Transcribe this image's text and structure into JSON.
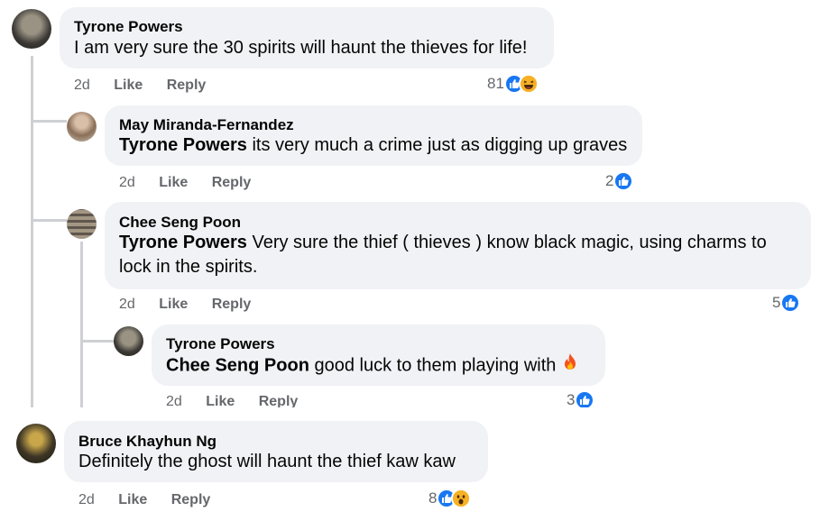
{
  "comments": [
    {
      "author": "Tyrone Powers",
      "text": "I am very sure the 30 spirits will haunt the thieves for life!",
      "time": "2d",
      "like": "Like",
      "reply": "Reply",
      "reaction_count": "81",
      "reactions": [
        "like-icon",
        "haha-icon"
      ]
    },
    {
      "author": "May Miranda-Fernandez",
      "mention": "Tyrone Powers",
      "text": " its very much a crime just as digging up graves",
      "time": "2d",
      "like": "Like",
      "reply": "Reply",
      "reaction_count": "2",
      "reactions": [
        "like-icon"
      ]
    },
    {
      "author": "Chee Seng Poon",
      "mention": "Tyrone Powers",
      "text_line1": " Very sure the thief ( thieves ) know black magic, using charms to",
      "text_line2": "lock in the spirits.",
      "time": "2d",
      "like": "Like",
      "reply": "Reply",
      "reaction_count": "5",
      "reactions": [
        "like-icon"
      ]
    },
    {
      "author": "Tyrone Powers",
      "mention": "Chee Seng Poon",
      "text": " good luck to them playing with ",
      "time": "2d",
      "like": "Like",
      "reply": "Reply",
      "reaction_count": "3",
      "reactions": [
        "like-icon"
      ]
    },
    {
      "author": "Bruce Khayhun Ng",
      "text": "Definitely the ghost will haunt the thief kaw kaw",
      "time": "2d",
      "like": "Like",
      "reply": "Reply",
      "reaction_count": "8",
      "reactions": [
        "like-icon",
        "wow-icon"
      ]
    }
  ],
  "colors": {
    "bubble": "#f0f2f5",
    "meta": "#65676b",
    "like_blue": "#1877f2",
    "reaction_yellow": "#f7b125"
  }
}
